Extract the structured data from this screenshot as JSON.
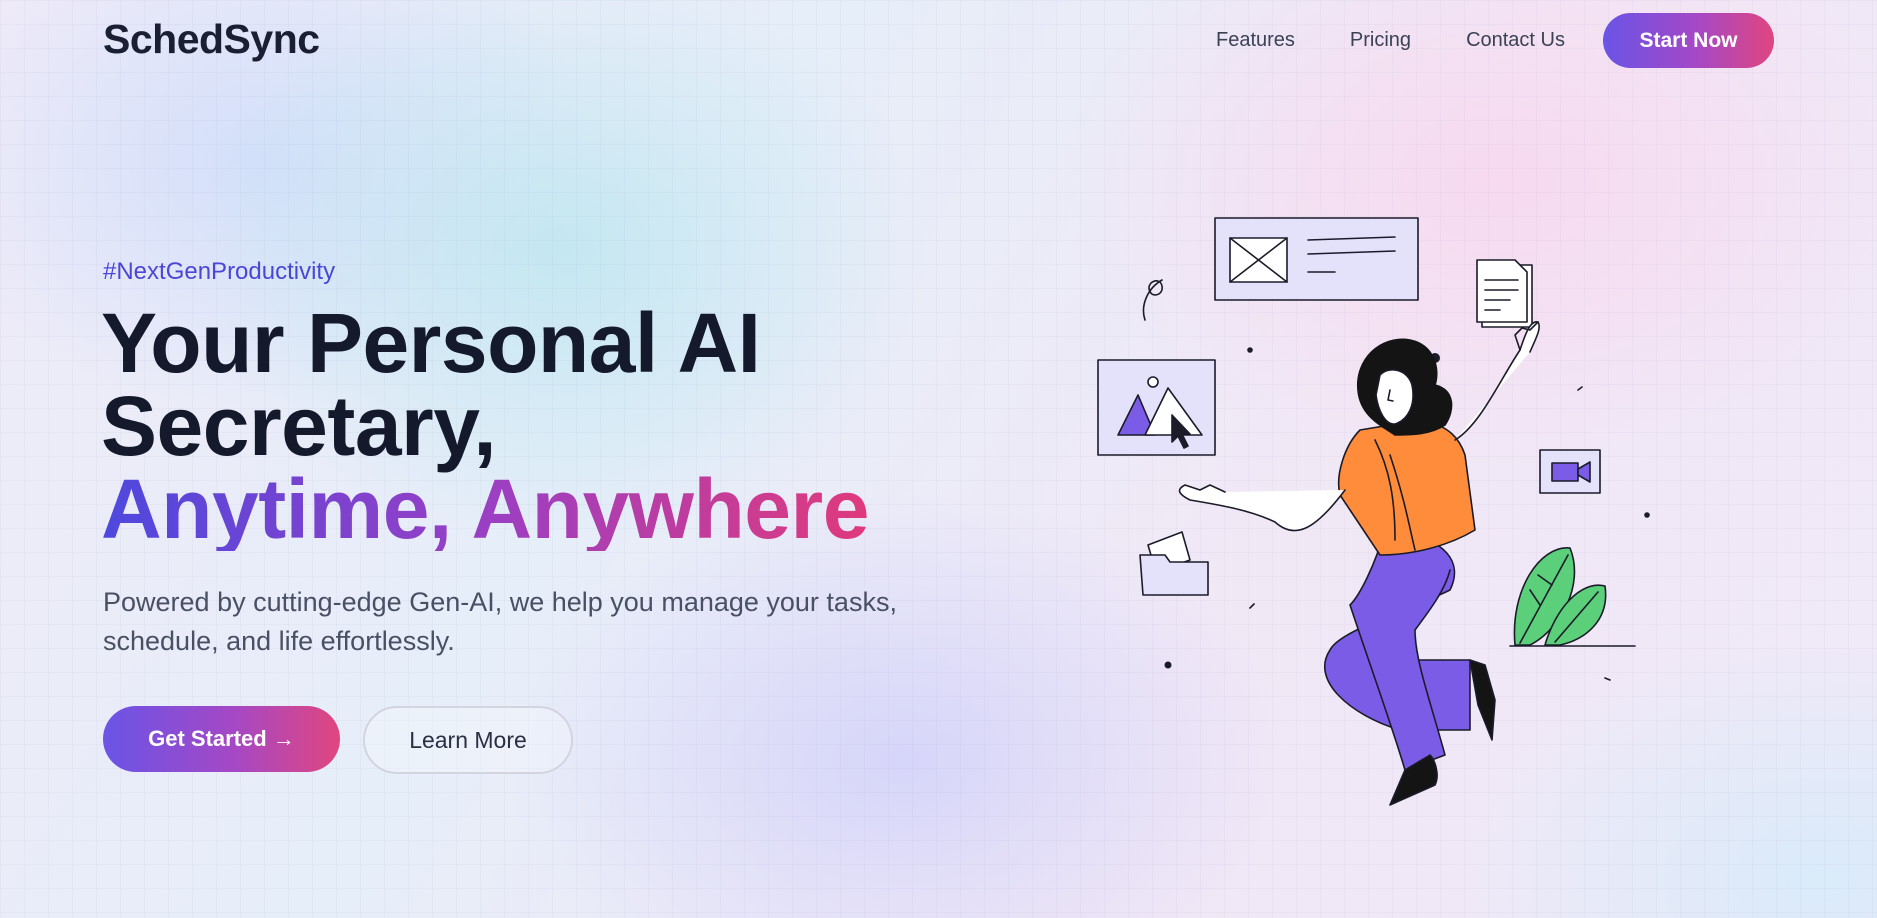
{
  "nav": {
    "logo": "SchedSync",
    "links": [
      "Features",
      "Pricing",
      "Contact Us"
    ],
    "cta_label": "Start Now"
  },
  "hero": {
    "hashtag": "#NextGenProductivity",
    "headline_line1": "Your Personal AI",
    "headline_line2": "Secretary,",
    "headline_line3": "Anytime, Anywhere",
    "subtitle": "Powered by cutting-edge Gen-AI, we help you manage your tasks, schedule, and life effortlessly.",
    "primary_cta": "Get Started →",
    "secondary_cta": "Learn More"
  },
  "colors": {
    "brand_start": "#6a54e6",
    "brand_end": "#e0467f",
    "accent_purple": "#7b5ce6",
    "accent_orange": "#ff8c3a",
    "accent_green": "#5bcf7a"
  },
  "icons": [
    "image-card-icon",
    "document-icon",
    "video-camera-icon",
    "folder-icon",
    "media-card-icon",
    "plant-icon"
  ]
}
